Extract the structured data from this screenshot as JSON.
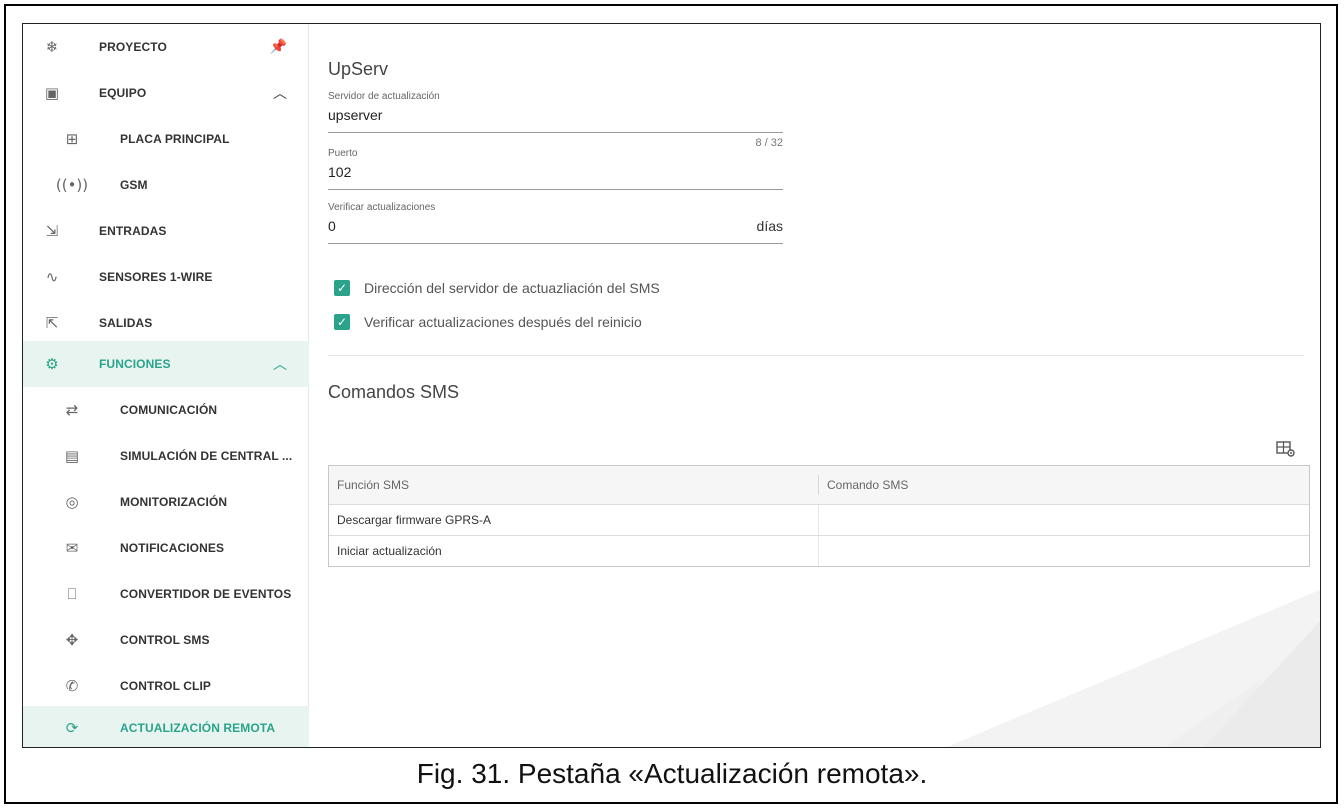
{
  "sidebar": {
    "items": [
      {
        "label": "PROYECTO",
        "icon": "snowflake-icon",
        "trail": "pin-icon"
      },
      {
        "label": "EQUIPO",
        "icon": "chip-icon",
        "trail": "chevron-up-icon"
      },
      {
        "label": "PLACA PRINCIPAL",
        "icon": "board-icon"
      },
      {
        "label": "GSM",
        "icon": "antenna-icon"
      },
      {
        "label": "ENTRADAS",
        "icon": "input-icon"
      },
      {
        "label": "SENSORES 1-WIRE",
        "icon": "sensor-icon"
      },
      {
        "label": "SALIDAS",
        "icon": "output-icon"
      },
      {
        "label": "FUNCIONES",
        "icon": "gear-icon",
        "trail": "chevron-up-icon"
      },
      {
        "label": "COMUNICACIÓN",
        "icon": "arrows-icon"
      },
      {
        "label": "SIMULACIÓN DE CENTRAL ...",
        "icon": "panel-icon"
      },
      {
        "label": "MONITORIZACIÓN",
        "icon": "eye-icon"
      },
      {
        "label": "NOTIFICACIONES",
        "icon": "message-icon"
      },
      {
        "label": "CONVERTIDOR DE EVENTOS",
        "icon": "converter-icon"
      },
      {
        "label": "CONTROL SMS",
        "icon": "sms-control-icon"
      },
      {
        "label": "CONTROL CLIP",
        "icon": "phone-clip-icon"
      },
      {
        "label": "ACTUALIZACIÓN REMOTA",
        "icon": "refresh-icon"
      }
    ]
  },
  "upserv": {
    "title": "UpServ",
    "server_label": "Servidor de actualización",
    "server_value": "upserver",
    "server_counter": "8 / 32",
    "port_label": "Puerto",
    "port_value": "102",
    "check_label": "Verificar actualizaciones",
    "check_value": "0",
    "check_unit": "días",
    "opt1": "Dirección del servidor de actuazliación del SMS",
    "opt2": "Verificar actualizaciones después del reinicio"
  },
  "sms": {
    "title": "Comandos SMS",
    "columns": [
      "Función SMS",
      "Comando SMS"
    ],
    "rows": [
      {
        "function": "Descargar firmware GPRS-A",
        "command": ""
      },
      {
        "function": "Iniciar actualización",
        "command": ""
      }
    ]
  },
  "caption": "Fig. 31. Pestaña «Actualización remota».",
  "colors": {
    "accent": "#2ba38a",
    "active_bg": "#e7f4f0"
  }
}
